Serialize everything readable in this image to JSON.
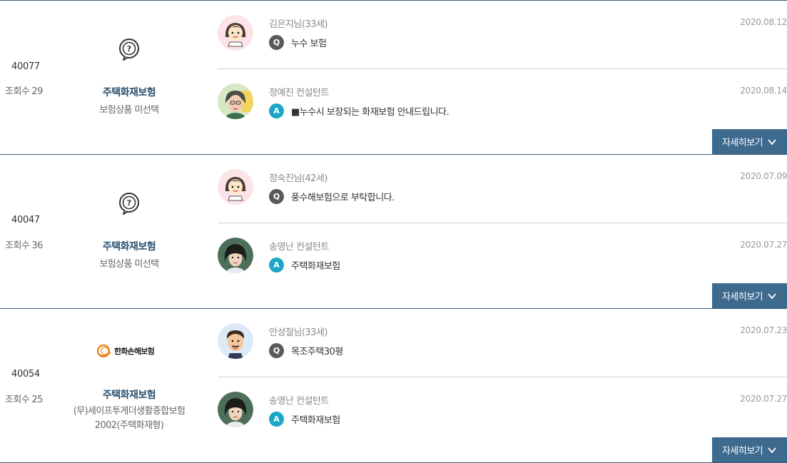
{
  "views_label": "조회수",
  "more_label": "자세히보기",
  "items": [
    {
      "number": "40077",
      "views": "29",
      "product_title": "주택화재보험",
      "product_sub": [
        "보험상품 미선택"
      ],
      "question": {
        "author": "김은지님(33세)",
        "date": "2020.08.12",
        "badge": "Q",
        "text": "누수 보험"
      },
      "answer": {
        "author": "정예진 컨설턴트",
        "date": "2020.08.14",
        "badge": "A",
        "text": "■누수시 보장되는 화재보험 안내드립니다."
      }
    },
    {
      "number": "40047",
      "views": "36",
      "product_title": "주택화재보험",
      "product_sub": [
        "보험상품 미선택"
      ],
      "question": {
        "author": "정숙진님(42세)",
        "date": "2020.07.09",
        "badge": "Q",
        "text": "풍수해보험으로 부탁합니다."
      },
      "answer": {
        "author": "송영난 컨설턴트",
        "date": "2020.07.27",
        "badge": "A",
        "text": "주택화재보험"
      }
    },
    {
      "number": "40054",
      "views": "25",
      "company_logo": "한화손해보험",
      "product_title": "주택화재보험",
      "product_sub": [
        "(무)세이프투게더생활종합보험",
        "2002(주택화재형)"
      ],
      "question": {
        "author": "안성철님(33세)",
        "date": "2020.07.23",
        "badge": "Q",
        "text": "목조주택30평"
      },
      "answer": {
        "author": "송영난 컨설턴트",
        "date": "2020.07.27",
        "badge": "A",
        "text": "주택화재보험"
      }
    }
  ]
}
